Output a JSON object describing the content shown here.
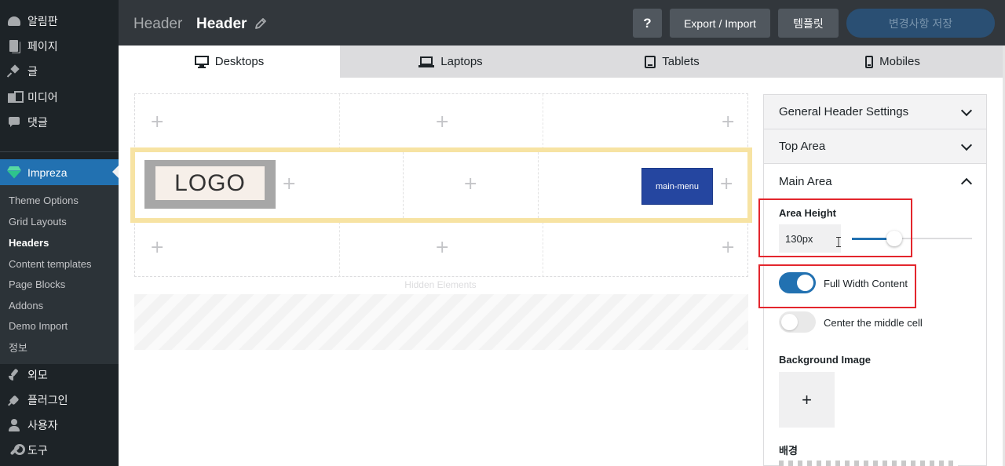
{
  "sidebar": {
    "items_top": [
      {
        "label": "알림판",
        "icon": "dashboard-icon"
      },
      {
        "label": "페이지",
        "icon": "pages-icon"
      },
      {
        "label": "글",
        "icon": "pin-icon"
      },
      {
        "label": "미디어",
        "icon": "media-icon"
      },
      {
        "label": "댓글",
        "icon": "comments-icon"
      }
    ],
    "active": {
      "label": "Impreza",
      "icon": "impreza-gem-icon"
    },
    "submenu": [
      "Theme Options",
      "Grid Layouts",
      "Headers",
      "Content templates",
      "Page Blocks",
      "Addons",
      "Demo Import",
      "정보"
    ],
    "submenu_active": "Headers",
    "items_bottom": [
      {
        "label": "외모",
        "icon": "appearance-icon"
      },
      {
        "label": "플러그인",
        "icon": "plugins-icon"
      },
      {
        "label": "사용자",
        "icon": "users-icon"
      },
      {
        "label": "도구",
        "icon": "tools-icon"
      }
    ]
  },
  "topbar": {
    "crumb_section": "Header",
    "crumb_title": "Header",
    "help_label": "?",
    "export_label": "Export / Import",
    "template_label": "템플릿",
    "save_label": "변경사항 저장"
  },
  "tabs": [
    {
      "label": "Desktops",
      "icon": "desktop-icon",
      "active": true
    },
    {
      "label": "Laptops",
      "icon": "laptop-icon",
      "active": false
    },
    {
      "label": "Tablets",
      "icon": "tablet-icon",
      "active": false
    },
    {
      "label": "Mobiles",
      "icon": "mobile-icon",
      "active": false
    }
  ],
  "editor": {
    "plus": "+",
    "logo_text": "LOGO",
    "menu_label": "main-menu",
    "hidden_label": "Hidden Elements"
  },
  "panel": {
    "general_label": "General Header Settings",
    "top_label": "Top Area",
    "main_label": "Main Area",
    "area_height_label": "Area Height",
    "area_height_value": "130px",
    "area_height_slider_fraction": 0.35,
    "full_width_label": "Full Width Content",
    "full_width_on": true,
    "center_label": "Center the middle cell",
    "center_on": false,
    "bg_image_label": "Background Image",
    "bg_image_plus": "+",
    "bg_label": "배경"
  },
  "colors": {
    "sidebar_bg": "#1d2327",
    "accent": "#2271b1",
    "main_row_highlight": "#f7e3a3",
    "menu_button": "#2546a0",
    "annotation_red": "#e3262d"
  }
}
